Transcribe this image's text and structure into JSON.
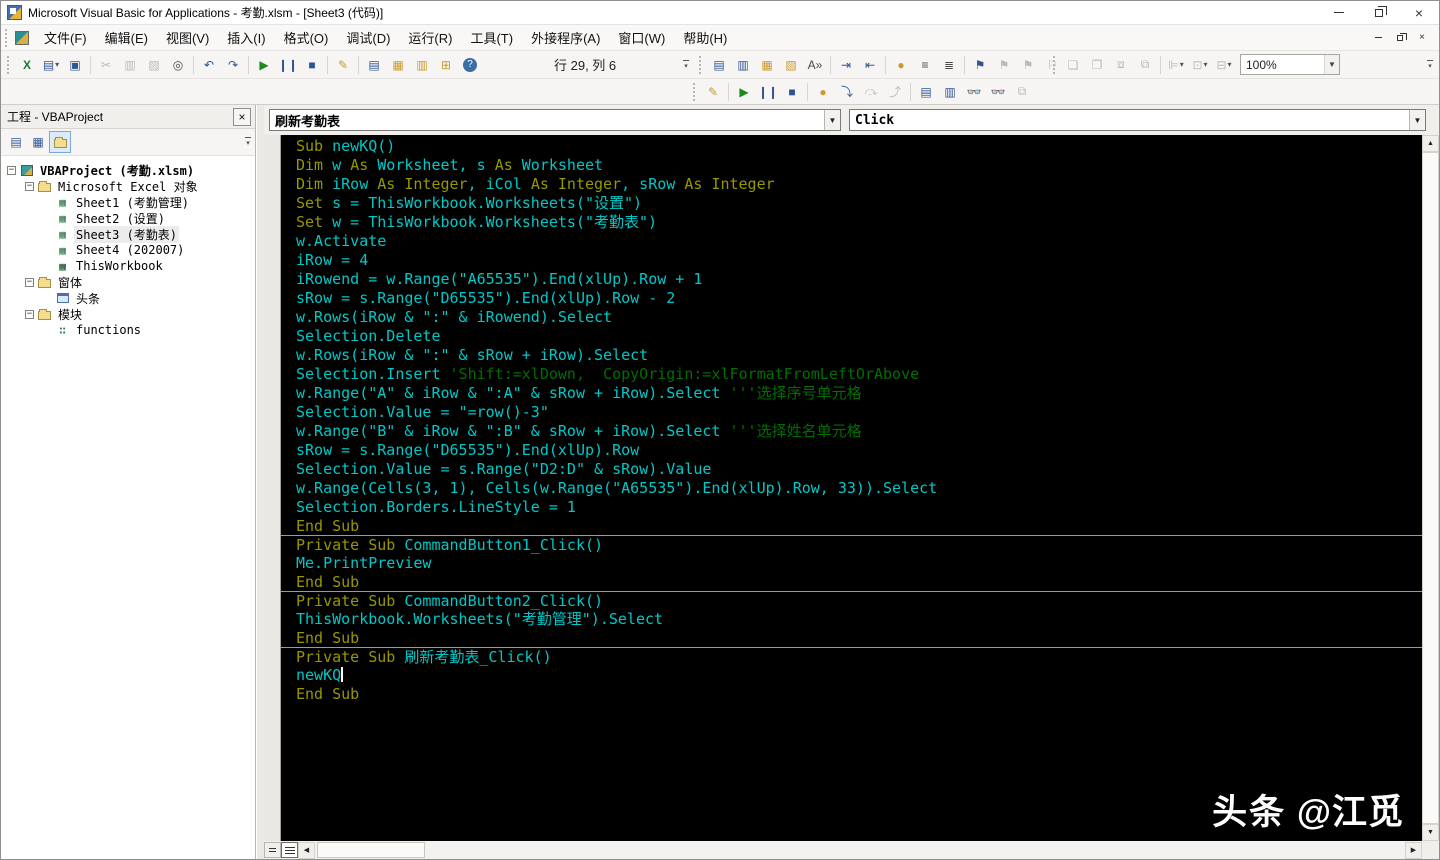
{
  "window": {
    "title": "Microsoft Visual Basic for Applications - 考勤.xlsm - [Sheet3 (代码)]"
  },
  "menu": {
    "items": [
      "文件(F)",
      "编辑(E)",
      "视图(V)",
      "插入(I)",
      "格式(O)",
      "调试(D)",
      "运行(R)",
      "工具(T)",
      "外接程序(A)",
      "窗口(W)",
      "帮助(H)"
    ]
  },
  "toolbars": {
    "standard": {
      "line_col": "行 29, 列 6",
      "icons": [
        {
          "name": "view-microsoft-excel-icon",
          "glyph": "X",
          "cls": "c-green"
        },
        {
          "name": "insert-userform-icon",
          "glyph": "▤",
          "cls": "c-blue",
          "dropdown": true
        },
        {
          "name": "save-icon",
          "glyph": "▣",
          "cls": "c-blue"
        },
        {
          "name": "cut-icon",
          "glyph": "✂",
          "disabled": true
        },
        {
          "name": "copy-icon",
          "glyph": "▥",
          "disabled": true
        },
        {
          "name": "paste-icon",
          "glyph": "▧",
          "disabled": true
        },
        {
          "name": "find-icon",
          "glyph": "◎"
        },
        {
          "name": "undo-icon",
          "glyph": "↶",
          "cls": "c-blue"
        },
        {
          "name": "redo-icon",
          "glyph": "↷",
          "cls": "c-blue"
        },
        {
          "name": "run-sub-icon",
          "glyph": "▶",
          "cls": "c-run"
        },
        {
          "name": "break-icon",
          "glyph": "❙❙",
          "cls": "c-blue"
        },
        {
          "name": "reset-icon",
          "glyph": "■",
          "cls": "c-blue"
        },
        {
          "name": "design-mode-icon",
          "glyph": "✎",
          "cls": "c-amber"
        },
        {
          "name": "project-explorer-icon",
          "glyph": "▤",
          "cls": "c-blue"
        },
        {
          "name": "properties-window-icon",
          "glyph": "▦",
          "cls": "c-amber"
        },
        {
          "name": "object-browser-icon",
          "glyph": "▥",
          "cls": "c-amber"
        },
        {
          "name": "toolbox-icon",
          "glyph": "⊞",
          "cls": "c-amber"
        },
        {
          "name": "help-icon",
          "glyph": "?",
          "help": true
        }
      ]
    },
    "edit": {
      "icons": [
        {
          "name": "list-properties-icon",
          "glyph": "▤",
          "cls": "c-blue"
        },
        {
          "name": "list-constants-icon",
          "glyph": "▥",
          "cls": "c-blue"
        },
        {
          "name": "quick-info-icon",
          "glyph": "▦",
          "cls": "c-amber"
        },
        {
          "name": "parameter-info-icon",
          "glyph": "▧",
          "cls": "c-amber"
        },
        {
          "name": "complete-word-icon",
          "glyph": "A»"
        },
        {
          "name": "indent-icon",
          "glyph": "⇥",
          "cls": "c-blue"
        },
        {
          "name": "outdent-icon",
          "glyph": "⇤",
          "cls": "c-blue"
        },
        {
          "name": "toggle-breakpoint-icon",
          "glyph": "●",
          "cls": "c-amber"
        },
        {
          "name": "comment-block-icon",
          "glyph": "≡"
        },
        {
          "name": "uncomment-block-icon",
          "glyph": "≣"
        },
        {
          "name": "toggle-bookmark-icon",
          "glyph": "⚑",
          "cls": "c-blue"
        },
        {
          "name": "next-bookmark-icon",
          "glyph": "⚑",
          "disabled": true
        },
        {
          "name": "previous-bookmark-icon",
          "glyph": "⚑",
          "disabled": true
        },
        {
          "name": "clear-bookmarks-icon",
          "glyph": "⚐",
          "disabled": true
        }
      ]
    },
    "userform": {
      "zoom_value": "100%",
      "icons": [
        {
          "name": "bring-to-front-icon",
          "glyph": "❏",
          "disabled": true
        },
        {
          "name": "send-to-back-icon",
          "glyph": "❐",
          "disabled": true
        },
        {
          "name": "group-icon",
          "glyph": "⧈",
          "disabled": true
        },
        {
          "name": "ungroup-icon",
          "glyph": "⧉",
          "disabled": true
        },
        {
          "name": "align-icon",
          "glyph": "⊫",
          "disabled": true,
          "dropdown": true
        },
        {
          "name": "center-icon",
          "glyph": "⊡",
          "disabled": true,
          "dropdown": true
        },
        {
          "name": "arrange-buttons-icon",
          "glyph": "⊟",
          "disabled": true,
          "dropdown": true
        }
      ]
    },
    "debug": {
      "icons": [
        {
          "name": "design-mode-icon",
          "glyph": "✎",
          "cls": "c-amber"
        },
        {
          "name": "run-icon",
          "glyph": "▶",
          "cls": "c-run"
        },
        {
          "name": "break-icon",
          "glyph": "❙❙",
          "cls": "c-blue"
        },
        {
          "name": "reset-icon",
          "glyph": "■",
          "cls": "c-blue"
        },
        {
          "name": "toggle-breakpoint-icon",
          "glyph": "●",
          "cls": "c-amber"
        },
        {
          "name": "step-into-icon",
          "glyph": "⤵",
          "cls": "c-blue"
        },
        {
          "name": "step-over-icon",
          "glyph": "⤼",
          "disabled": true
        },
        {
          "name": "step-out-icon",
          "glyph": "⤴",
          "disabled": true
        },
        {
          "name": "locals-window-icon",
          "glyph": "▤",
          "cls": "c-blue"
        },
        {
          "name": "immediate-window-icon",
          "glyph": "▥",
          "cls": "c-blue"
        },
        {
          "name": "watch-window-icon",
          "glyph": "👓",
          "cls": "c-blue"
        },
        {
          "name": "quick-watch-icon",
          "glyph": "👓"
        },
        {
          "name": "call-stack-icon",
          "glyph": "⧉",
          "disabled": true
        }
      ]
    }
  },
  "project_panel": {
    "title": "工程 - VBAProject",
    "toolbar": [
      {
        "name": "view-code-icon",
        "glyph": "▤"
      },
      {
        "name": "view-object-icon",
        "glyph": "▦"
      },
      {
        "name": "toggle-folders-icon",
        "glyph": "folder",
        "active": true
      }
    ],
    "tree": [
      {
        "level": 0,
        "icon": "project",
        "label": "VBAProject (考勤.xlsm)",
        "bold": true,
        "expander": "-"
      },
      {
        "level": 1,
        "icon": "folder",
        "label": "Microsoft Excel 对象",
        "expander": "-"
      },
      {
        "level": 2,
        "icon": "sheet",
        "label": "Sheet1 (考勤管理)"
      },
      {
        "level": 2,
        "icon": "sheet",
        "label": "Sheet2 (设置)"
      },
      {
        "level": 2,
        "icon": "sheet",
        "label": "Sheet3 (考勤表)",
        "selected": true
      },
      {
        "level": 2,
        "icon": "sheet",
        "label": "Sheet4 (202007)"
      },
      {
        "level": 2,
        "icon": "workbook",
        "label": "ThisWorkbook"
      },
      {
        "level": 1,
        "icon": "folder",
        "label": "窗体",
        "expander": "-"
      },
      {
        "level": 2,
        "icon": "form",
        "label": "头条"
      },
      {
        "level": 1,
        "icon": "folder",
        "label": "模块",
        "expander": "-"
      },
      {
        "level": 2,
        "icon": "module",
        "label": "functions"
      }
    ]
  },
  "code_window": {
    "object_dropdown": "刷新考勤表",
    "procedure_dropdown": "Click",
    "watermark_bold": "头条",
    "watermark_light": " @江觅",
    "lines": [
      {
        "segs": [
          [
            "k",
            "Sub "
          ],
          [
            "c",
            "newKQ()"
          ]
        ]
      },
      {
        "segs": [
          [
            "k",
            "Dim "
          ],
          [
            "c",
            "w "
          ],
          [
            "k",
            "As "
          ],
          [
            "c",
            "Worksheet, s "
          ],
          [
            "k",
            "As "
          ],
          [
            "c",
            "Worksheet"
          ]
        ]
      },
      {
        "segs": [
          [
            "k",
            "Dim "
          ],
          [
            "c",
            "iRow "
          ],
          [
            "k",
            "As Integer"
          ],
          [
            "c",
            ", iCol "
          ],
          [
            "k",
            "As Integer"
          ],
          [
            "c",
            ", sRow "
          ],
          [
            "k",
            "As Integer"
          ]
        ]
      },
      {
        "segs": [
          [
            "k",
            "Set "
          ],
          [
            "c",
            "s = ThisWorkbook.Worksheets(\"设置\")"
          ]
        ]
      },
      {
        "segs": [
          [
            "k",
            "Set "
          ],
          [
            "c",
            "w = ThisWorkbook.Worksheets(\"考勤表\")"
          ]
        ]
      },
      {
        "segs": [
          [
            "c",
            "w.Activate"
          ]
        ]
      },
      {
        "segs": [
          [
            "c",
            "iRow = 4"
          ]
        ]
      },
      {
        "segs": [
          [
            "c",
            "iRowend = w.Range(\"A65535\").End(xlUp).Row + 1"
          ]
        ]
      },
      {
        "segs": [
          [
            "c",
            "sRow = s.Range(\"D65535\").End(xlUp).Row - 2"
          ]
        ]
      },
      {
        "segs": [
          [
            "c",
            "w.Rows(iRow & \":\" & iRowend).Select"
          ]
        ]
      },
      {
        "segs": [
          [
            "c",
            "Selection.Delete"
          ]
        ]
      },
      {
        "segs": [
          [
            "c",
            "w.Rows(iRow & \":\" & sRow + iRow).Select"
          ]
        ]
      },
      {
        "segs": [
          [
            "c",
            "Selection.Insert "
          ],
          [
            "m",
            "'Shift:=xlDown,  CopyOrigin:=xlFormatFromLeftOrAbove"
          ]
        ]
      },
      {
        "segs": [
          [
            "c",
            "w.Range(\"A\" & iRow & \":A\" & sRow + iRow).Select "
          ],
          [
            "m",
            "'''选择序号单元格"
          ]
        ]
      },
      {
        "segs": [
          [
            "c",
            "Selection.Value = \"=row()-3\""
          ]
        ]
      },
      {
        "segs": [
          [
            "c",
            "w.Range(\"B\" & iRow & \":B\" & sRow + iRow).Select "
          ],
          [
            "m",
            "'''选择姓名单元格"
          ]
        ]
      },
      {
        "segs": [
          [
            "c",
            "sRow = s.Range(\"D65535\").End(xlUp).Row"
          ]
        ]
      },
      {
        "segs": [
          [
            "c",
            "Selection.Value = s.Range(\"D2:D\" & sRow).Value"
          ]
        ]
      },
      {
        "segs": [
          [
            "c",
            "w.Range(Cells(3, 1), Cells(w.Range(\"A65535\").End(xlUp).Row, 33)).Select"
          ]
        ]
      },
      {
        "segs": [
          [
            "c",
            "Selection.Borders.LineStyle = 1"
          ]
        ]
      },
      {
        "segs": [
          [
            "k",
            "End Sub"
          ]
        ]
      },
      {
        "sep": true,
        "segs": [
          [
            "k",
            "Private Sub "
          ],
          [
            "c",
            "CommandButton1_Click()"
          ]
        ]
      },
      {
        "segs": [
          [
            "c",
            "Me.PrintPreview"
          ]
        ]
      },
      {
        "segs": [
          [
            "k",
            "End Sub"
          ]
        ]
      },
      {
        "sep": true,
        "segs": [
          [
            "k",
            "Private Sub "
          ],
          [
            "c",
            "CommandButton2_Click()"
          ]
        ]
      },
      {
        "segs": [
          [
            "c",
            "ThisWorkbook.Worksheets(\"考勤管理\").Select"
          ]
        ]
      },
      {
        "segs": [
          [
            "k",
            "End Sub"
          ]
        ]
      },
      {
        "sep": true,
        "segs": [
          [
            "k",
            "Private Sub "
          ],
          [
            "c",
            "刷新考勤表_Click()"
          ]
        ]
      },
      {
        "segs": [
          [
            "c",
            "newKQ"
          ]
        ],
        "caret": true
      },
      {
        "segs": [
          [
            "k",
            "End Sub"
          ]
        ]
      }
    ]
  }
}
